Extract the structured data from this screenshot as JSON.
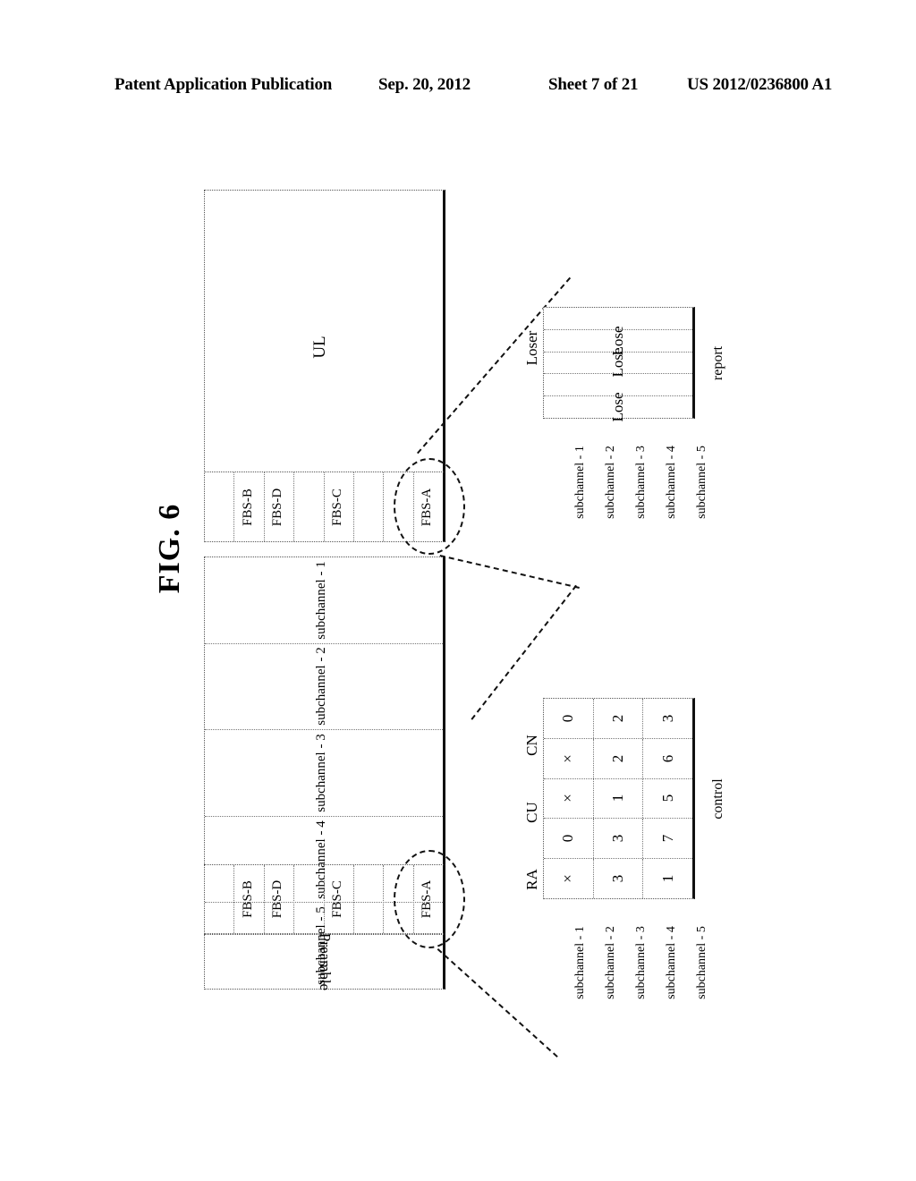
{
  "header": {
    "publication": "Patent Application Publication",
    "date": "Sep. 20, 2012",
    "sheet": "Sheet 7 of 21",
    "patent_number": "US 2012/0236800 A1"
  },
  "figure": {
    "title": "FIG. 6"
  },
  "ul_frame": {
    "label": "UL",
    "fbs_cells": [
      "",
      "FBS-B",
      "FBS-D",
      "",
      "FBS-C",
      "",
      "",
      "FBS-A"
    ],
    "highlight_cell": "FBS-A"
  },
  "dl_frame": {
    "preamble_label": "Preamble",
    "subchannels": [
      "subchannel - 1",
      "subchannel - 2",
      "subchannel - 3",
      "subchannel - 4",
      "subchannel - 5"
    ],
    "fbs_cells": [
      "",
      "FBS-B",
      "FBS-D",
      "",
      "FBS-C",
      "",
      "",
      "FBS-A"
    ],
    "highlight_cell": "FBS-A"
  },
  "report_table": {
    "caption": "report",
    "columns": [
      "Loser"
    ],
    "row_labels": [
      "subchannel - 1",
      "subchannel - 2",
      "subchannel - 3",
      "subchannel - 4",
      "subchannel - 5"
    ],
    "rows": [
      [
        ""
      ],
      [
        "Lose"
      ],
      [
        "Lose"
      ],
      [
        ""
      ],
      [
        "Lose"
      ]
    ]
  },
  "control_table": {
    "caption": "control",
    "columns": [
      "RA",
      "CU",
      "CN"
    ],
    "row_labels": [
      "subchannel - 1",
      "subchannel - 2",
      "subchannel - 3",
      "subchannel - 4",
      "subchannel - 5"
    ],
    "rows": [
      [
        "0",
        "2",
        "3"
      ],
      [
        "×",
        "2",
        "6"
      ],
      [
        "×",
        "1",
        "5"
      ],
      [
        "0",
        "3",
        "7"
      ],
      [
        "×",
        "3",
        "1"
      ]
    ]
  },
  "colors": {
    "ink": "#000000",
    "frame_solid": "#111111",
    "frame_dotted": "#555555"
  }
}
